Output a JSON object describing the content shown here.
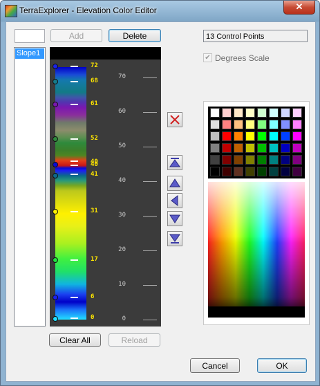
{
  "window": {
    "title": "TerraExplorer - Elevation Color Editor",
    "close_glyph": "✕"
  },
  "top_buttons": {
    "add": "Add",
    "delete": "Delete"
  },
  "name_input": {
    "value": ""
  },
  "list": {
    "items": [
      "Slope1"
    ]
  },
  "info": {
    "control_points": "13 Control Points"
  },
  "degrees_scale": {
    "label": "Degrees Scale",
    "checked": true
  },
  "ruler_ticks": [
    "70",
    "60",
    "50",
    "40",
    "30",
    "20",
    "10",
    "0"
  ],
  "control_points": [
    {
      "label": "72",
      "color": "#1a22e8"
    },
    {
      "label": "68",
      "color": "#157a8a"
    },
    {
      "label": "61",
      "color": "#7a18b0"
    },
    {
      "label": "52",
      "color": "#2e8a3c"
    },
    {
      "label": "40",
      "color": "#e04018"
    },
    {
      "label": "40",
      "color": "#0a0ad6"
    },
    {
      "label": "41",
      "color": "#0c6a8a"
    },
    {
      "label": "31",
      "color": "#fff000"
    },
    {
      "label": "17",
      "color": "#20e040"
    },
    {
      "label": "6",
      "color": "#1a20f0"
    },
    {
      "label": "0",
      "color": "#22e0ff"
    }
  ],
  "side_icons": [
    "delete-point-icon",
    "move-top-icon",
    "move-up-icon",
    "move-left-icon",
    "move-down-icon",
    "move-bottom-icon"
  ],
  "palette": {
    "swatch_colors": [
      "#ffffff",
      "#ffd0d0",
      "#ffe8c8",
      "#ffffc8",
      "#d0ffd0",
      "#d0ffff",
      "#d0d8ff",
      "#ffd0ff",
      "#e0e0e0",
      "#ff8080",
      "#ffc080",
      "#ffff80",
      "#80ff80",
      "#80ffff",
      "#8090ff",
      "#ff80ff",
      "#c0c0c0",
      "#ff0000",
      "#ff8000",
      "#ffff00",
      "#00ff00",
      "#00ffff",
      "#0040ff",
      "#ff00ff",
      "#808080",
      "#c00000",
      "#c06000",
      "#c0c000",
      "#00c000",
      "#00c0c0",
      "#0000c0",
      "#c000c0",
      "#404040",
      "#800000",
      "#804000",
      "#808000",
      "#008000",
      "#008080",
      "#000080",
      "#800080",
      "#000000",
      "#400000",
      "#603020",
      "#404000",
      "#004000",
      "#004040",
      "#000040",
      "#400040"
    ]
  },
  "bottom_buttons": {
    "clear_all": "Clear All",
    "reload": "Reload",
    "cancel": "Cancel",
    "ok": "OK"
  }
}
